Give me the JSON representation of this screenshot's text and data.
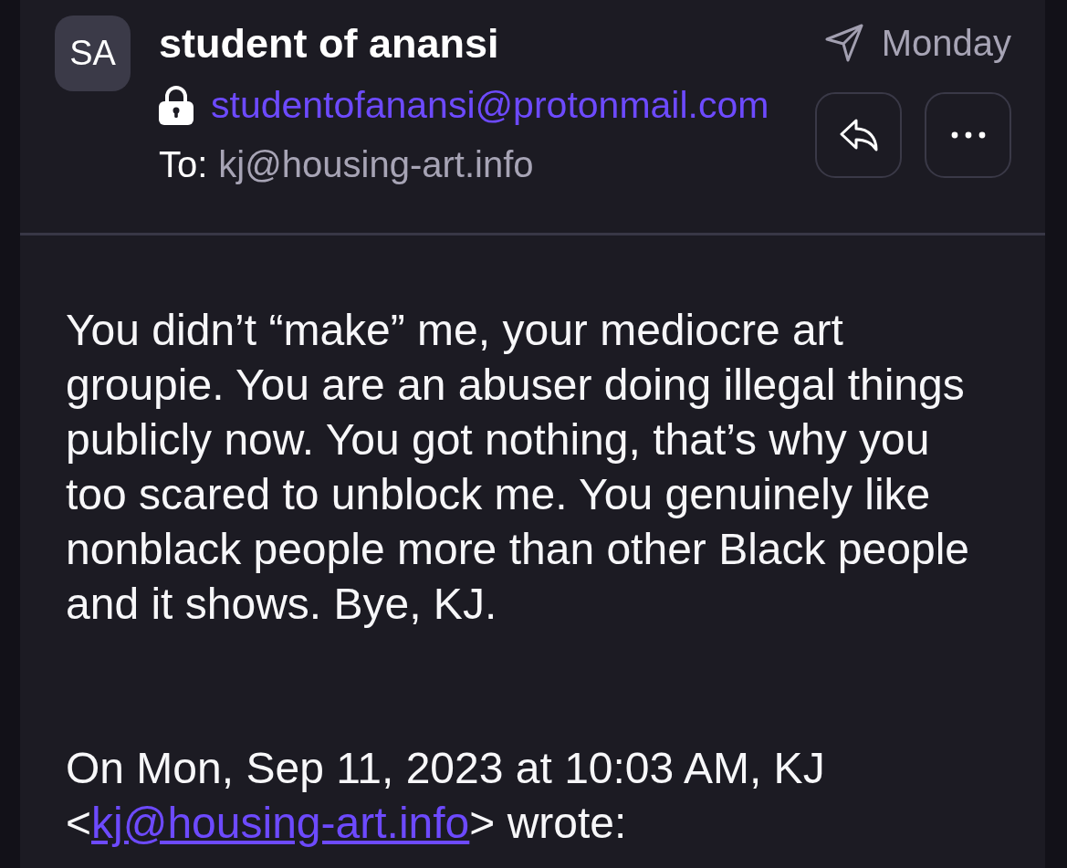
{
  "sender": {
    "initials": "SA",
    "name": "student of anansi",
    "email": "studentofanansi@protonmail.com",
    "encrypted": true
  },
  "recipient": {
    "label": "To:",
    "address": "kj@housing-art.info"
  },
  "meta": {
    "sent": true,
    "date": "Monday"
  },
  "actions": [
    {
      "kind": "reply"
    },
    {
      "kind": "more"
    }
  ],
  "body": "You didn’t “make” me, your mediocre art groupie. You are an abuser doing illegal things publicly now. You got nothing, that’s why you too scared to unblock me. You genuinely like nonblack people more than other Black people and it shows. Bye, KJ.",
  "quote_header": {
    "before": "On Mon, Sep 11, 2023 at 10:03 AM, KJ <",
    "link": "kj@housing-art.info",
    "after": "> wrote:"
  }
}
